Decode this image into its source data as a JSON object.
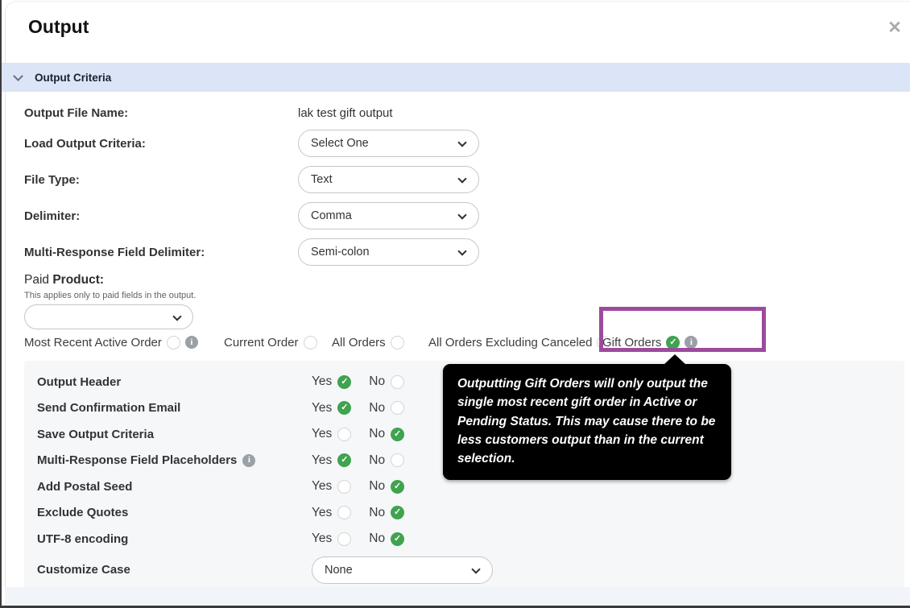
{
  "dialog": {
    "title": "Output",
    "close_icon": "✕"
  },
  "section": {
    "title": "Output Criteria"
  },
  "fields": {
    "output_file_name": {
      "label": "Output File Name:",
      "value": "lak test gift output"
    },
    "load_output_criteria": {
      "label": "Load Output Criteria:",
      "value": "Select One"
    },
    "file_type": {
      "label": "File Type:",
      "value": "Text"
    },
    "delimiter": {
      "label": "Delimiter:",
      "value": "Comma"
    },
    "multi_response_delimiter": {
      "label": "Multi-Response Field Delimiter:",
      "value": "Semi-colon"
    }
  },
  "paid_product": {
    "label_normal": "Paid",
    "label_bold": "Product:",
    "helper": "This applies only to paid fields in the output.",
    "dropdown_value": "",
    "options": [
      {
        "label": "Most Recent Active Order",
        "selected": false,
        "has_info": true
      },
      {
        "label": "Current Order",
        "selected": false,
        "has_info": false
      },
      {
        "label": "All Orders",
        "selected": false,
        "has_info": false
      },
      {
        "label": "All Orders Excluding Canceled",
        "selected": false,
        "has_info": false
      },
      {
        "label": "Gift Orders",
        "selected": true,
        "has_info": true
      }
    ]
  },
  "tooltip": {
    "text": "Outputting Gift Orders will only output the single most recent gift order in Active or Pending Status. This may cause there to be less customers output than in the current selection."
  },
  "toggles": [
    {
      "label": "Output Header",
      "value": "yes",
      "has_info": false
    },
    {
      "label": "Send Confirmation Email",
      "value": "yes",
      "has_info": false
    },
    {
      "label": "Save Output Criteria",
      "value": "no",
      "has_info": false
    },
    {
      "label": "Multi-Response Field Placeholders",
      "value": "yes",
      "has_info": true
    },
    {
      "label": "Add Postal Seed",
      "value": "no",
      "has_info": false
    },
    {
      "label": "Exclude Quotes",
      "value": "no",
      "has_info": false
    },
    {
      "label": "UTF-8 encoding",
      "value": "no",
      "has_info": false
    }
  ],
  "toggle_labels": {
    "yes": "Yes",
    "no": "No"
  },
  "customize_case": {
    "label": "Customize Case",
    "value": "None"
  },
  "colors": {
    "accent_green": "#3fa34f",
    "annotation_purple": "#9d4a9e",
    "section_header_bg": "#dce5f7",
    "tooltip_bg": "#000000"
  }
}
